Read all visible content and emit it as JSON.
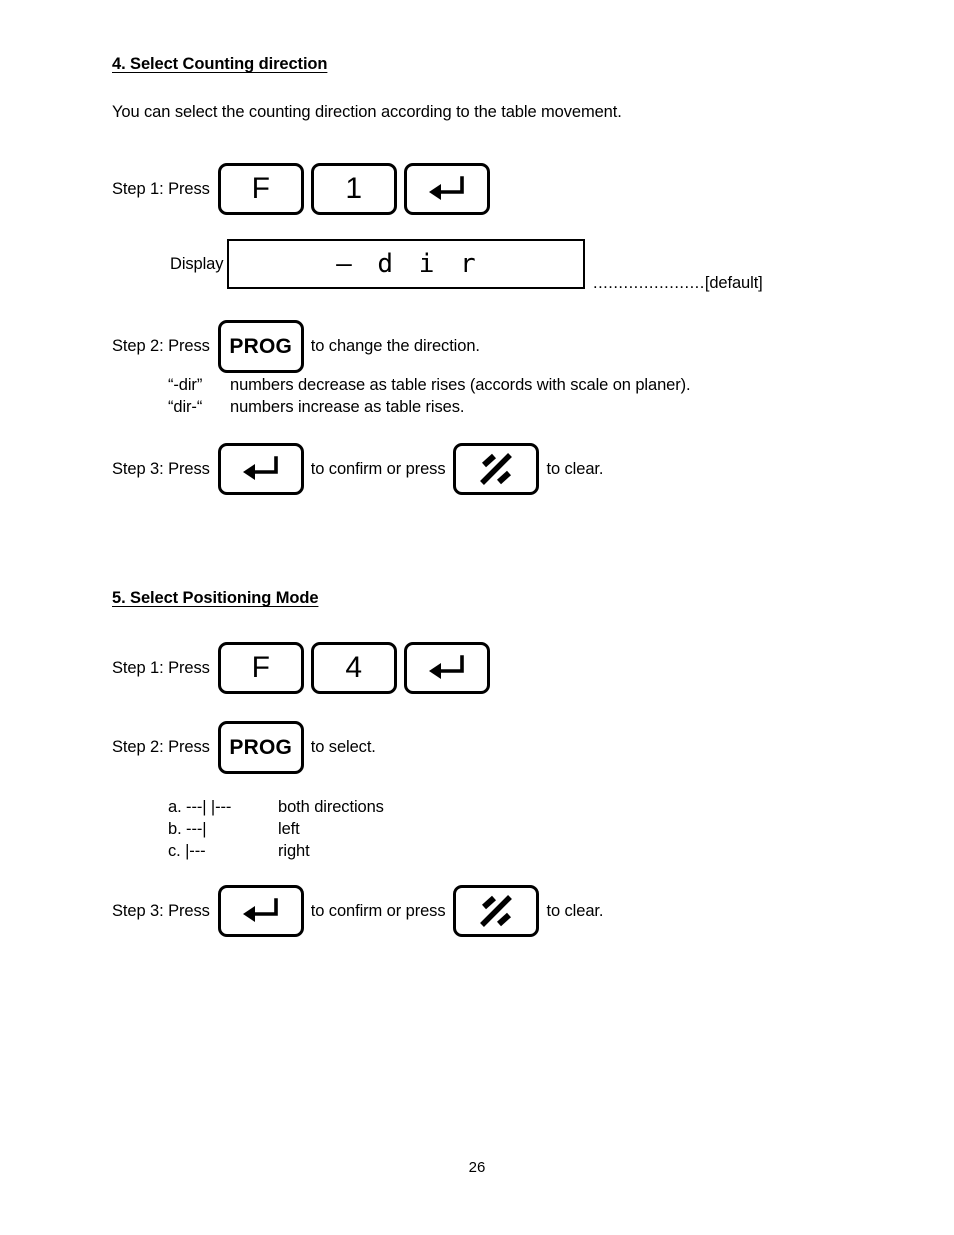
{
  "document": {
    "page_number": "26"
  },
  "sections": [
    {
      "heading": "4. Select Counting direction",
      "intro": "You can select the counting direction according to the table movement.",
      "step1": {
        "label": "Step 1: Press",
        "keys": [
          {
            "name": "function-key",
            "glyph": "F"
          },
          {
            "name": "digit-key-1",
            "glyph": "1"
          },
          {
            "name": "enter-key",
            "glyph": "enter-arrow-icon"
          }
        ]
      },
      "display": {
        "label": "Display",
        "value": "— d i r",
        "leader_dots": "......................",
        "leader_note": "[default]"
      },
      "step2": {
        "label": "Step 2: Press",
        "key": {
          "name": "prog-key",
          "glyph": "PROG"
        },
        "trailing": "to change the direction."
      },
      "notes": [
        {
          "term": "“-dir”",
          "text": "numbers decrease as table rises (accords with scale on planer)."
        },
        {
          "term": "“dir-“",
          "text": "numbers increase as table rises."
        }
      ],
      "step3": {
        "label": "Step 3: Press",
        "confirm_key": {
          "name": "enter-key",
          "glyph": "enter-arrow-icon"
        },
        "middle": "to confirm or press",
        "clear_key": {
          "name": "clear-key",
          "glyph": "clear-slash-icon"
        },
        "trailing": "to clear."
      }
    },
    {
      "heading": "5. Select Positioning Mode",
      "step1": {
        "label": "Step 1: Press",
        "keys": [
          {
            "name": "function-key",
            "glyph": "F"
          },
          {
            "name": "digit-key-4",
            "glyph": "4"
          },
          {
            "name": "enter-key",
            "glyph": "enter-arrow-icon"
          }
        ]
      },
      "step2": {
        "label": "Step 2: Press",
        "key": {
          "name": "prog-key",
          "glyph": "PROG"
        },
        "trailing": "to select."
      },
      "options": [
        {
          "symbol": "a. ---| |---",
          "text": "both directions"
        },
        {
          "symbol": "b. ---|",
          "text": "left"
        },
        {
          "symbol": "c. |---",
          "text": "right"
        }
      ],
      "step3": {
        "label": "Step 3: Press",
        "confirm_key": {
          "name": "enter-key",
          "glyph": "enter-arrow-icon"
        },
        "middle": "to confirm or press",
        "clear_key": {
          "name": "clear-key",
          "glyph": "clear-slash-icon"
        },
        "trailing": "to clear."
      }
    }
  ]
}
